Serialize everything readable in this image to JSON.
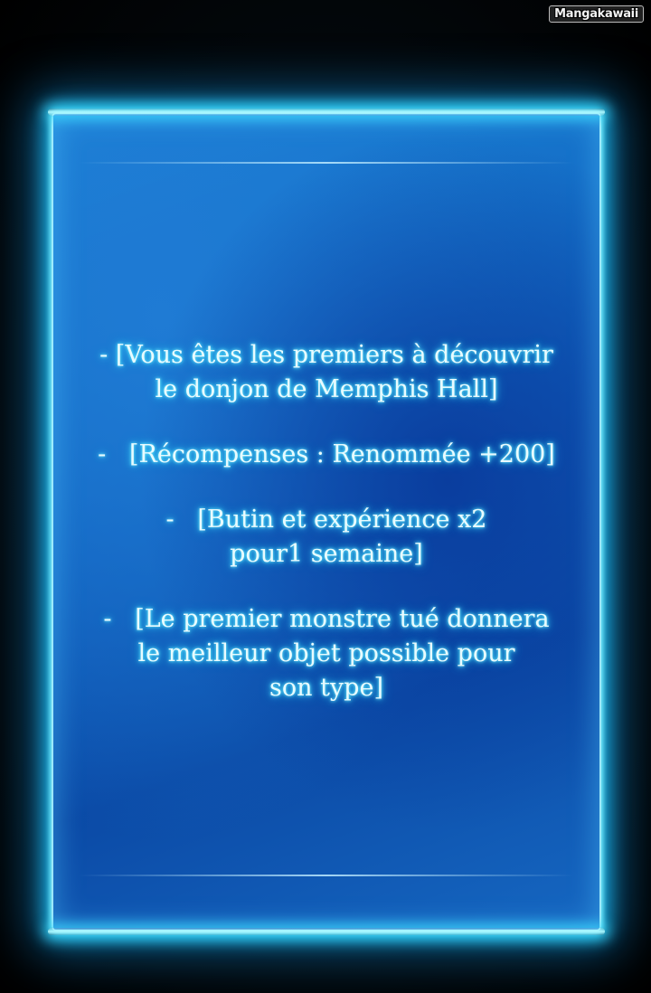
{
  "watermark": "Mangakawaii",
  "messages": [
    {
      "lines": [
        "- [Vous êtes les premiers à découvrir",
        "le donjon de Memphis Hall]"
      ]
    },
    {
      "lines": [
        "-   [Récompenses : Renommée +200]"
      ]
    },
    {
      "lines": [
        "-   [Butin et expérience x2",
        "pour1 semaine]"
      ]
    },
    {
      "lines": [
        "-   [Le premier monstre tué donnera",
        "le meilleur objet possible pour",
        "son type]"
      ]
    }
  ],
  "colors": {
    "panel": "#0f5dbb",
    "glow": "#3fdcff",
    "text": "#e8fbff"
  }
}
